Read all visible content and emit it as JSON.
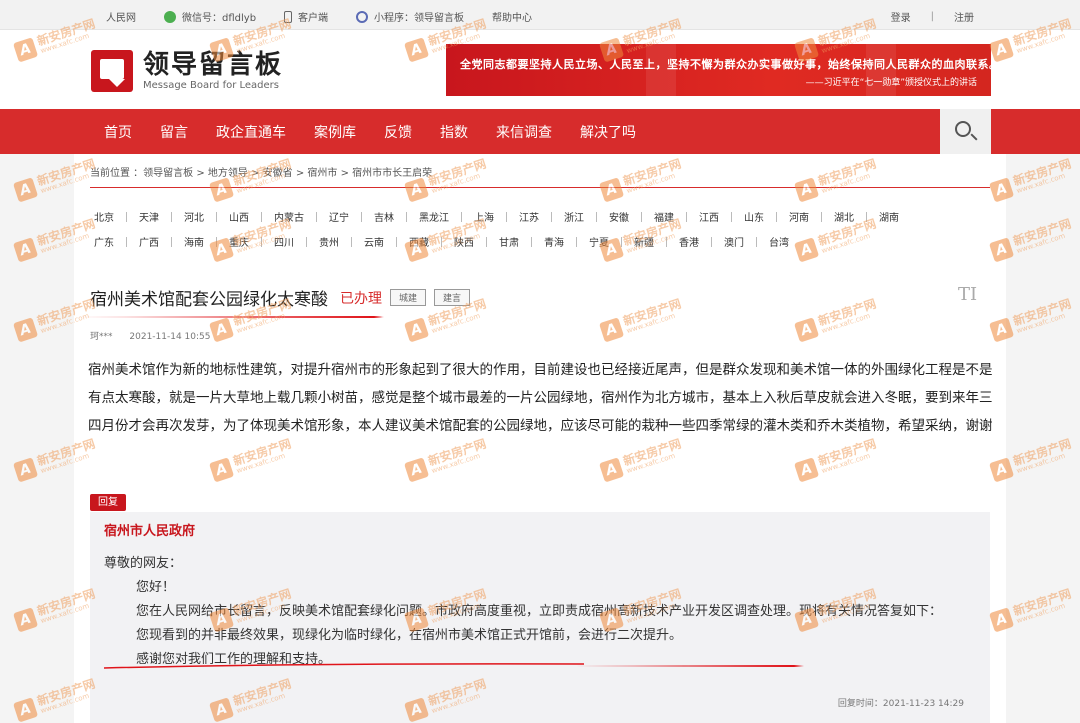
{
  "topbar": {
    "site": "人民网",
    "wechat": "微信号：dfldlyb",
    "client": "客户端",
    "miniprogram": "小程序：领导留言板",
    "help": "帮助中心",
    "login": "登录",
    "sep": "|",
    "register": "注册"
  },
  "logo": {
    "cn": "领导留言板",
    "en": "Message Board for Leaders"
  },
  "banner": {
    "line1": "全党同志都要坚持人民立场、人民至上，坚持不懈为群众办实事做好事，始终保持同人民群众的血肉联系。",
    "line2": "——习近平在“七一勋章”颁授仪式上的讲话"
  },
  "nav": [
    "首页",
    "留言",
    "政企直通车",
    "案例库",
    "反馈",
    "指数",
    "来信调查",
    "解决了吗"
  ],
  "breadcrumb": "当前位置 ：领导留言板 > 地方领导 > 安徽省 > 宿州市 > 宿州市市长王启荣",
  "regions": [
    [
      "北京",
      "天津",
      "河北",
      "山西",
      "内蒙古",
      "辽宁",
      "吉林",
      "黑龙江",
      "上海",
      "江苏",
      "浙江",
      "安徽",
      "福建",
      "江西",
      "山东",
      "河南",
      "湖北",
      "湖南"
    ],
    [
      "广东",
      "广西",
      "海南",
      "重庆",
      "四川",
      "贵州",
      "云南",
      "西藏",
      "陕西",
      "甘肃",
      "青海",
      "宁夏",
      "新疆",
      "香港",
      "澳门",
      "台湾"
    ]
  ],
  "message": {
    "title": "宿州美术馆配套公园绿化太寒酸",
    "status": "已办理",
    "tags": [
      "城建",
      "建言"
    ],
    "corner": "TI",
    "author": "珂***",
    "time": "2021-11-14 10:55",
    "body": "宿州美术馆作为新的地标性建筑，对提升宿州市的形象起到了很大的作用，目前建设也已经接近尾声，但是群众发现和美术馆一体的外围绿化工程是不是有点太寒酸，就是一片大草地上载几颗小树苗，感觉是整个城市最差的一片公园绿地，宿州作为北方城市，基本上入秋后草皮就会进入冬眠，要到来年三四月份才会再次发芽，为了体现美术馆形象，本人建议美术馆配套的公园绿地，应该尽可能的栽种一些四季常绿的灌木类和乔木类植物，希望采纳，谢谢"
  },
  "reply": {
    "tab": "回复",
    "org": "宿州市人民政府",
    "greeting": "尊敬的网友：",
    "hello": "您好！",
    "p1": "您在人民网给市长留言，反映美术馆配套绿化问题。市政府高度重视，立即责成宿州高新技术产业开发区调查处理。现将有关情况答复如下：",
    "p2": "您现看到的并非最终效果，现绿化为临时绿化，在宿州市美术馆正式开馆前，会进行二次提升。",
    "p3": "感谢您对我们工作的理解和支持。",
    "time": "回复时间：2021-11-23 14:29"
  },
  "watermark": {
    "mark": "A",
    "name": "新安房产网",
    "url": "www.xafc.com"
  }
}
